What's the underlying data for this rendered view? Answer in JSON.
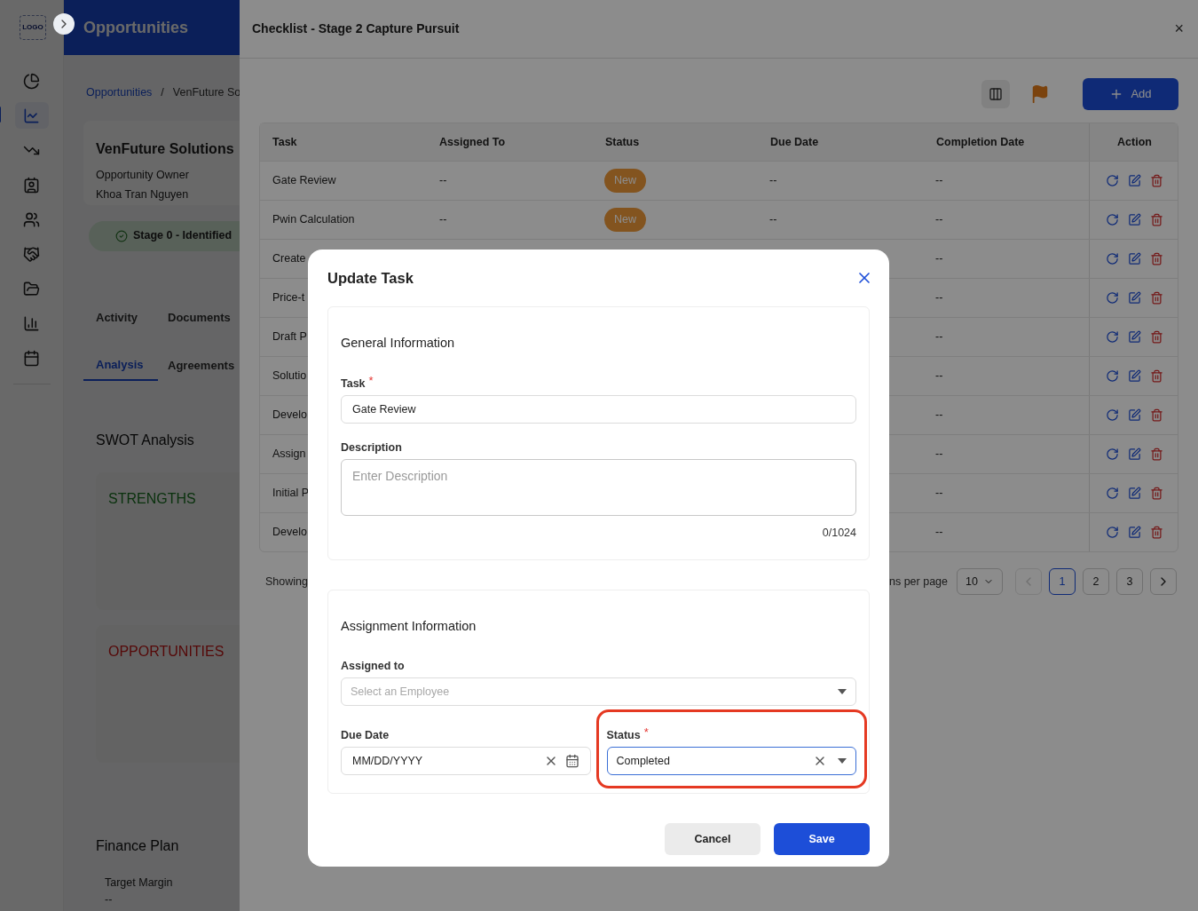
{
  "sidebar": {
    "logo": "LOGO",
    "items": [
      {
        "selected": false
      },
      {
        "selected": true
      },
      {
        "selected": false
      },
      {
        "selected": false
      },
      {
        "selected": false
      },
      {
        "selected": false
      },
      {
        "selected": false
      },
      {
        "selected": false
      },
      {
        "selected": false
      }
    ]
  },
  "page": {
    "title": "Opportunities",
    "breadcrumb": [
      "Opportunities",
      "/",
      "VenFuture So"
    ],
    "company": "VenFuture Solutions",
    "owner_label": "Opportunity Owner",
    "owner": "Khoa Tran Nguyen",
    "stage": "Stage 0 - Identified",
    "tabs": [
      {
        "label": "Activity",
        "selected": false
      },
      {
        "label": "Documents",
        "selected": false
      },
      {
        "label": "Analysis",
        "selected": true
      },
      {
        "label": "Agreements",
        "selected": false
      }
    ],
    "swot_title": "SWOT Analysis",
    "swot": [
      {
        "label": "STRENGTHS",
        "kind": "strength"
      },
      {
        "label": "OPPORTUNITIES",
        "kind": "opportunity"
      }
    ],
    "finance_title": "Finance Plan",
    "finance": [
      {
        "label": "Target Margin",
        "value": "--"
      }
    ]
  },
  "drawer": {
    "title": "Checklist - Stage 2 Capture Pursuit",
    "close": "×",
    "add_button": "Add",
    "table": {
      "columns": [
        "Task",
        "Assigned To",
        "Status",
        "Due Date",
        "Completion Date",
        "Action"
      ],
      "rows": [
        {
          "task": "Gate Review",
          "assigned_to": "--",
          "status": "New",
          "due_date": "--",
          "completion_date": "--"
        },
        {
          "task": "Pwin Calculation",
          "assigned_to": "--",
          "status": "New",
          "due_date": "--",
          "completion_date": "--"
        },
        {
          "task": "Create ",
          "completion_date": "--"
        },
        {
          "task": "Price-t",
          "completion_date": "--"
        },
        {
          "task": "Draft P",
          "completion_date": "--"
        },
        {
          "task": "Solutio",
          "completion_date": "--"
        },
        {
          "task": "Develo",
          "completion_date": "--"
        },
        {
          "task": "Assign",
          "completion_date": "--"
        },
        {
          "task": "Initial P",
          "completion_date": "--"
        },
        {
          "task": "Develo",
          "completion_date": "--"
        }
      ]
    },
    "pagination": {
      "showing": "Showing",
      "per_page_label": "ns per page",
      "per_page": "10",
      "pages": [
        {
          "label": "1",
          "selected": true
        },
        {
          "label": "2",
          "selected": false
        },
        {
          "label": "3",
          "selected": false
        }
      ],
      "prev_disabled": true
    }
  },
  "modal": {
    "title": "Update Task",
    "sections": [
      {
        "title": "General Information",
        "fields": [
          {
            "kind": "text",
            "label": "Task",
            "required": true,
            "required_mark": "*",
            "value": "Gate Review"
          },
          {
            "kind": "textarea",
            "label": "Description",
            "placeholder": "Enter Description",
            "counter": "0/1024"
          }
        ]
      },
      {
        "title": "Assignment Information",
        "fields": [
          {
            "kind": "select",
            "label": "Assigned to",
            "placeholder": "Select an Employee"
          },
          {
            "kind": "date",
            "label": "Due Date",
            "value": "MM/DD/YYYY"
          },
          {
            "kind": "select",
            "label": "Status",
            "required": true,
            "required_mark": "*",
            "value": "Completed",
            "highlighted": true
          }
        ]
      }
    ],
    "buttons": [
      {
        "label": "Cancel",
        "kind": "secondary"
      },
      {
        "label": "Save",
        "kind": "primary"
      }
    ]
  }
}
